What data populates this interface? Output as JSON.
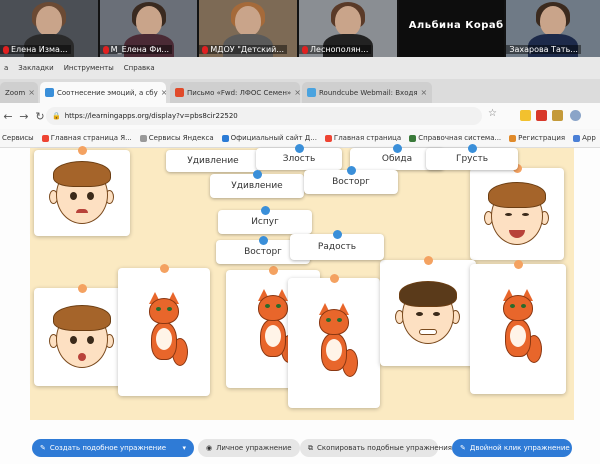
{
  "participants": [
    {
      "name": "Елена Изма..."
    },
    {
      "name": "М_Елена Фи..."
    },
    {
      "name": "МДОУ \"Детский..."
    },
    {
      "name": "Леснополян..."
    }
  ],
  "active_speaker": {
    "name": "Альбина Кораб...",
    "label": "Захарова Тать..."
  },
  "menu": [
    "a",
    "Закладки",
    "Инструменты",
    "Справка"
  ],
  "tabs": [
    {
      "label": "Zoom"
    },
    {
      "label": "Соотнесение эмоций, а сбу"
    },
    {
      "label": "Письмо «Fwd: ЛФОС Семен»"
    },
    {
      "label": "Roundcube Webmail: Входя"
    }
  ],
  "address": {
    "url": "https://learningapps.org/display?v=pbs8cir22520"
  },
  "bookmarks": [
    "Сервисы",
    "Главная страница Я...",
    "Сервисы Яндекса",
    "Официальный сайт Д...",
    "Главная страница",
    "Справочная система...",
    "Регистрация",
    "App"
  ],
  "words": {
    "w1": "Удивление",
    "w2": "Злость",
    "w3": "Обида",
    "w4": "Грусть",
    "w5": "Удивление",
    "w6": "Восторг",
    "w7": "Испуг",
    "w8": "Восторг",
    "w9": "Радость"
  },
  "toolbar": {
    "create": "Создать подобное упражнение",
    "private": "Личное упражнение",
    "similar": "Скопировать подобные упражнения",
    "embed": "Двойной клик упражнение"
  },
  "colors": {
    "accent": "#2f7bd6",
    "board": "#fbeac2",
    "pin_orange": "#f4a261",
    "pin_blue": "#3a8fd9"
  },
  "icons": [
    "mic-muted-icon",
    "back-icon",
    "forward-icon",
    "reload-icon",
    "lock-icon",
    "star-icon",
    "plus-icon",
    "pencil-icon",
    "person-icon"
  ]
}
